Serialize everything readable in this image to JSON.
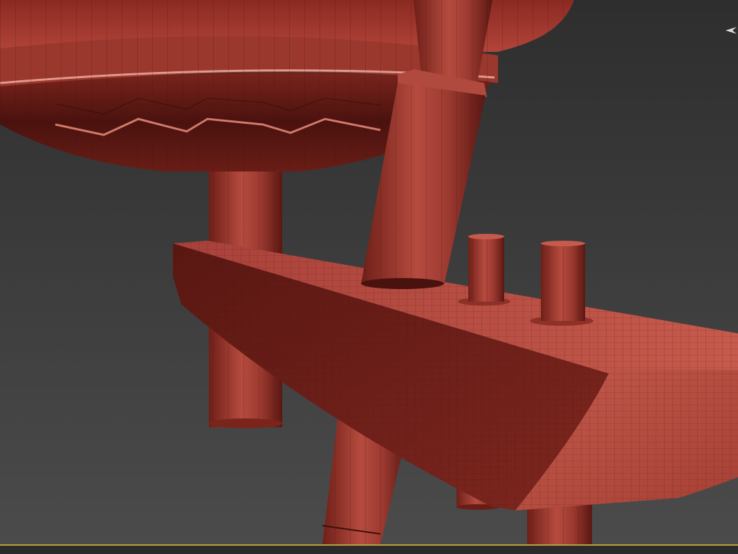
{
  "viewport": {
    "label": "",
    "background_top": "#2e2e2e",
    "background_bottom": "#4a4a4a"
  },
  "model": {
    "material_color": "#a8413a",
    "highlight_color": "#cf6a5c",
    "shadow_color": "#3d0f0c",
    "wire_color": "#5a1a15",
    "parts": [
      "bowl-dome",
      "bowl-rim",
      "bowl-underside",
      "center-column",
      "diagonal-leg",
      "crossbar-beam",
      "peg-left",
      "peg-right",
      "bottom-leg-right",
      "bottom-stub"
    ]
  },
  "status_bar": {
    "accent_color": "#b8a23a"
  }
}
